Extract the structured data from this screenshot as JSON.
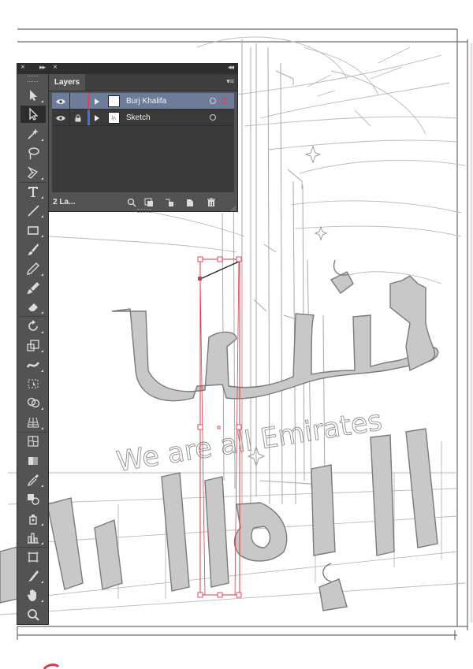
{
  "layers_panel": {
    "tab_label": "Layers",
    "footer_count": "2 La...",
    "layers": [
      {
        "name": "Burj Khalifa",
        "visible": true,
        "locked": false,
        "selected": true,
        "color": "#e0405a"
      },
      {
        "name": "Sketch",
        "visible": true,
        "locked": true,
        "selected": false,
        "color": "#4a6fd6"
      }
    ]
  },
  "tools_panel": {
    "tools": [
      "selection-tool-icon",
      "direct-selection-tool-icon",
      "magic-wand-tool-icon",
      "lasso-tool-icon",
      "pen-tool-icon",
      "type-tool-icon",
      "line-segment-tool-icon",
      "rectangle-tool-icon",
      "paintbrush-tool-icon",
      "pencil-tool-icon",
      "blob-brush-tool-icon",
      "eraser-tool-icon",
      "rotate-tool-icon",
      "scale-tool-icon",
      "width-tool-icon",
      "free-transform-tool-icon",
      "shape-builder-tool-icon",
      "perspective-grid-tool-icon",
      "mesh-tool-icon",
      "gradient-tool-icon",
      "eyedropper-tool-icon",
      "blend-tool-icon",
      "symbol-sprayer-tool-icon",
      "column-graph-tool-icon",
      "artboard-tool-icon",
      "slice-tool-icon",
      "hand-tool-icon",
      "zoom-tool-icon"
    ],
    "active_tool": "direct-selection-tool-icon"
  },
  "artwork": {
    "english_text": "We are all Emirates",
    "arabic_top": "كلنا",
    "arabic_bottom": "الإمارات",
    "accent_color": "#d9394e"
  }
}
